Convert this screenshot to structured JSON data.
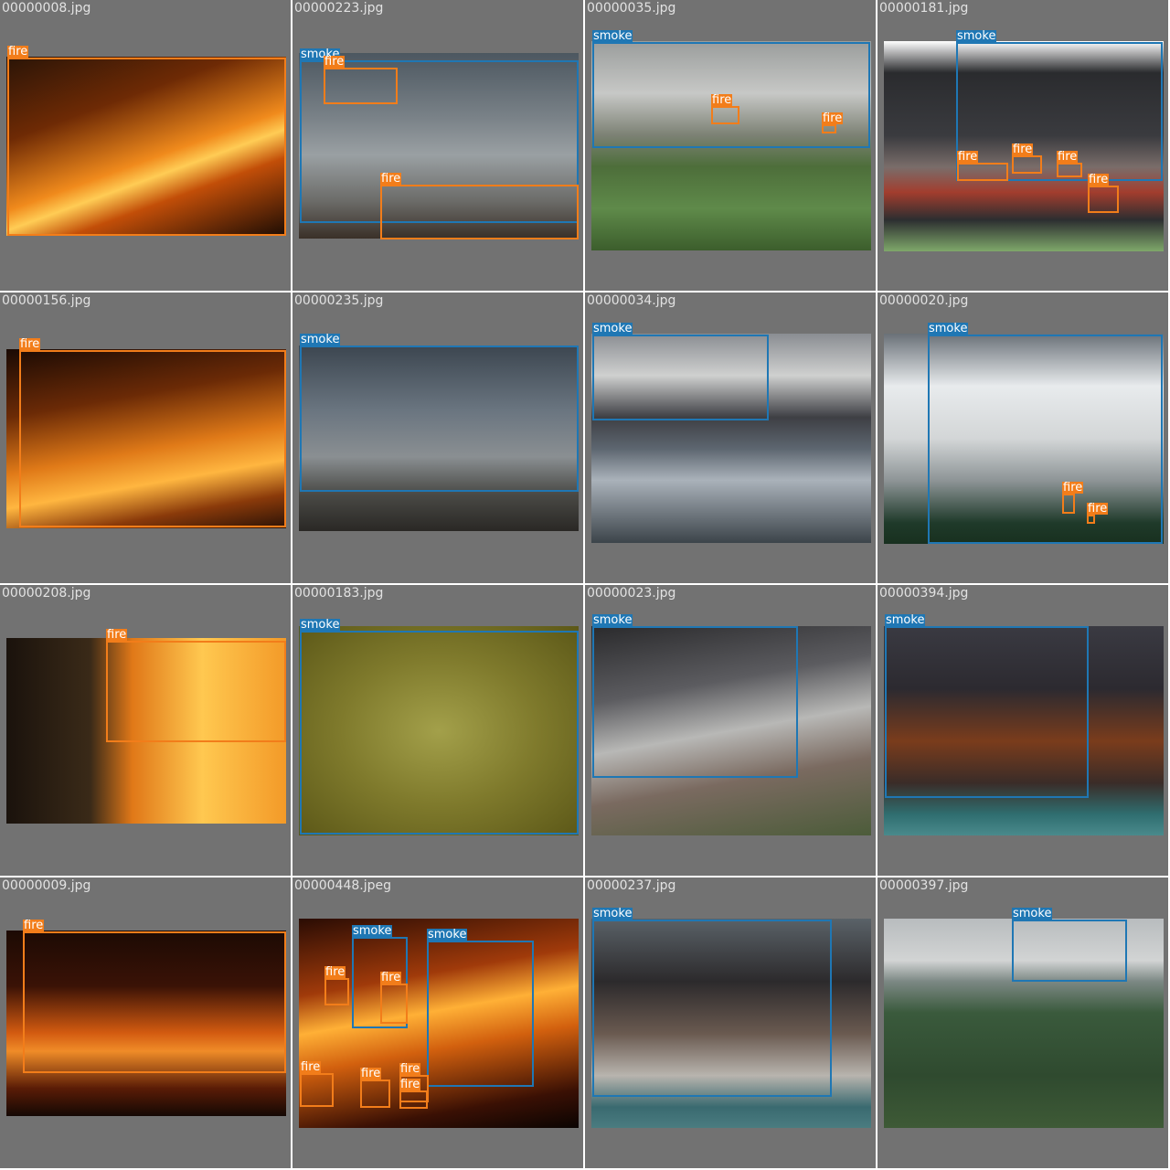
{
  "colors": {
    "fire": "#f27d1a",
    "smoke": "#1f77b4",
    "tile_bg": "#727272"
  },
  "tiles": [
    {
      "file": "00000008.jpg",
      "photo_bg": "linear-gradient(160deg,#2a1406 0%,#6e2a05 30%,#f08a1c 55%,#ffcc55 62%,#c24e08 72%,#1c0c04 100%)",
      "detections": [
        {
          "label": "fire"
        }
      ]
    },
    {
      "file": "00000223.jpg",
      "photo_bg": "linear-gradient(180deg,#4c5760 0%,#7a8288 35%,#9aa0a3 55%,#6b6b68 80%,#3a3028 100%)",
      "detections": [
        {
          "label": "smoke"
        },
        {
          "label": "fire"
        },
        {
          "label": "fire"
        }
      ]
    },
    {
      "file": "00000035.jpg",
      "photo_bg": "linear-gradient(180deg,#9a9d9c 0%,#c7c8c6 25%,#7c8174 45%,#4d6e3a 60%,#5f8a4a 80%,#3c5e2c 100%)",
      "detections": [
        {
          "label": "smoke"
        },
        {
          "label": "fire"
        },
        {
          "label": "fire"
        }
      ]
    },
    {
      "file": "00000181.jpg",
      "photo_bg": "linear-gradient(180deg,#ffffff 0%,#2a2b2e 15%,#3a3b3f 45%,#7a6d6a 60%,#a23d2e 72%,#2c2e30 85%,#7fa86a 100%)",
      "detections": [
        {
          "label": "smoke"
        },
        {
          "label": "fire"
        },
        {
          "label": "fire"
        },
        {
          "label": "fire"
        },
        {
          "label": "fire"
        }
      ]
    },
    {
      "file": "00000156.jpg",
      "photo_bg": "linear-gradient(170deg,#1a0a04 0%,#6b2a06 30%,#e07a18 55%,#ffb640 70%,#8a3a0a 85%,#2a1206 100%)",
      "detections": [
        {
          "label": "fire"
        }
      ]
    },
    {
      "file": "00000235.jpg",
      "photo_bg": "linear-gradient(180deg,#3c4650 0%,#6a7580 35%,#8a8f92 60%,#4a4a46 80%,#2a2825 100%)",
      "detections": [
        {
          "label": "smoke"
        }
      ]
    },
    {
      "file": "00000034.jpg",
      "photo_bg": "linear-gradient(180deg,#8a8d92 0%,#cfd0cf 20%,#3e3f44 40%,#5d6670 55%,#aab2ba 70%,#3c444a 100%)",
      "detections": [
        {
          "label": "smoke"
        }
      ]
    },
    {
      "file": "00000020.jpg",
      "photo_bg": "linear-gradient(180deg,#6a7178 0%,#e8ebed 25%,#d3d6d7 50%,#8d9496 70%,#1f3a2a 90%,#18301f 100%)",
      "detections": [
        {
          "label": "smoke"
        },
        {
          "label": "fire"
        },
        {
          "label": "fire"
        }
      ]
    },
    {
      "file": "00000208.jpg",
      "photo_bg": "linear-gradient(90deg,#1a120c 0%,#3a2a18 30%,#e07818 45%,#ffc850 70%,#f39a28 100%)",
      "detections": [
        {
          "label": "fire"
        }
      ]
    },
    {
      "file": "00000183.jpg",
      "photo_bg": "radial-gradient(ellipse at 50% 50%,#a3a04a 0%,#7f7a2c 50%,#5c5818 100%)",
      "detections": [
        {
          "label": "smoke"
        }
      ]
    },
    {
      "file": "00000023.jpg",
      "photo_bg": "linear-gradient(170deg,#2a2a2c 0%,#5c5c60 30%,#b8b8b6 50%,#7a6a60 70%,#4c5c3a 100%)",
      "detections": [
        {
          "label": "smoke"
        }
      ]
    },
    {
      "file": "00000394.jpg",
      "photo_bg": "linear-gradient(180deg,#3a3a42 0%,#2c2a30 30%,#7a3c1c 55%,#3a2c28 75%,#2f6e70 90%,#4a8a8c 100%)",
      "detections": [
        {
          "label": "smoke"
        }
      ]
    },
    {
      "file": "00000009.jpg",
      "photo_bg": "linear-gradient(180deg,#1c0a04 0%,#3a1206 30%,#d25a10 55%,#f08c28 65%,#5a1c06 85%,#140804 100%)",
      "detections": [
        {
          "label": "fire"
        }
      ]
    },
    {
      "file": "00000448.jpeg",
      "photo_bg": "linear-gradient(170deg,#2a0c04 0%,#a03a0a 30%,#ffb036 45%,#d2600e 60%,#3a1004 85%,#0a0402 100%)",
      "detections": [
        {
          "label": "smoke"
        },
        {
          "label": "smoke"
        },
        {
          "label": "fire"
        },
        {
          "label": "fire"
        },
        {
          "label": "fire"
        },
        {
          "label": "fire"
        },
        {
          "label": "fire"
        },
        {
          "label": "fire"
        }
      ]
    },
    {
      "file": "00000237.jpg",
      "photo_bg": "linear-gradient(180deg,#5a6268 0%,#2c2a2c 30%,#6a5a50 55%,#b8b4ae 75%,#3a6a70 90%,#4a7c80 100%)",
      "detections": [
        {
          "label": "smoke"
        }
      ]
    },
    {
      "file": "00000397.jpg",
      "photo_bg": "linear-gradient(180deg,#b8bcbe 0%,#d2d4d4 20%,#7c8884 30%,#3a5a3c 45%,#2f4a2f 75%,#3e5a36 100%)",
      "detections": [
        {
          "label": "smoke"
        }
      ]
    }
  ]
}
